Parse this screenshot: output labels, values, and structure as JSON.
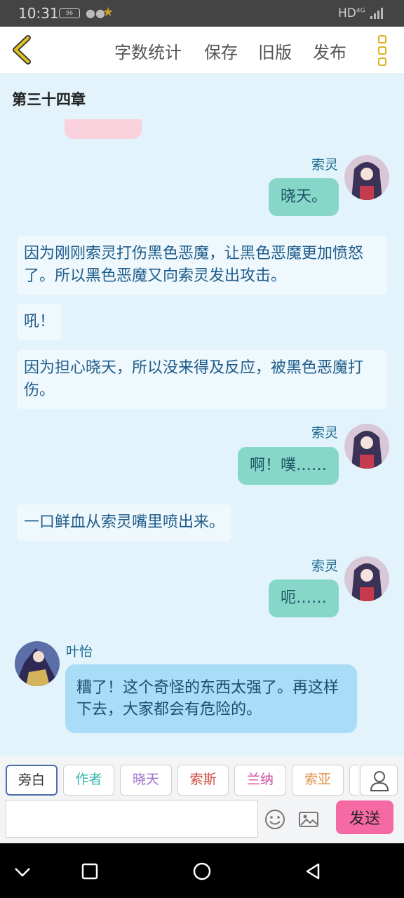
{
  "status_bar": {
    "time": "10:31",
    "battery": "96",
    "network": "HD",
    "network_gen": "4G"
  },
  "toolbar": {
    "actions": [
      "字数统计",
      "保存",
      "旧版",
      "发布"
    ]
  },
  "chapter": {
    "title": "第三十四章"
  },
  "messages": {
    "m1_name": "索灵",
    "m1_text": "晓天。",
    "n1": "因为刚刚索灵打伤黑色恶魔，让黑色恶魔更加愤怒了。所以黑色恶魔又向索灵发出攻击。",
    "n2": "吼！",
    "n3": "因为担心晓天，所以没来得及反应，被黑色恶魔打伤。",
    "m2_name": "索灵",
    "m2_text": "啊！噗……",
    "n4": "一口鲜血从索灵嘴里喷出来。",
    "m3_name": "索灵",
    "m3_text": "呃……",
    "m4_name": "叶怡",
    "m4_text": "糟了！这个奇怪的东西太强了。再这样下去，大家都会有危险的。"
  },
  "roles": [
    {
      "label": "旁白",
      "color": "#333333"
    },
    {
      "label": "作者",
      "color": "#2fb3a8"
    },
    {
      "label": "晓天",
      "color": "#a070d0"
    },
    {
      "label": "索斯",
      "color": "#d04a3a"
    },
    {
      "label": "兰纳",
      "color": "#d24aa0"
    },
    {
      "label": "索亚",
      "color": "#e0944a"
    }
  ],
  "composer": {
    "send_label": "发送",
    "input_value": ""
  },
  "colors": {
    "accent": "#d9b21e",
    "send": "#f56aa3",
    "right_bubble": "#87d7c9",
    "left_bubble": "#a8dcf7"
  }
}
